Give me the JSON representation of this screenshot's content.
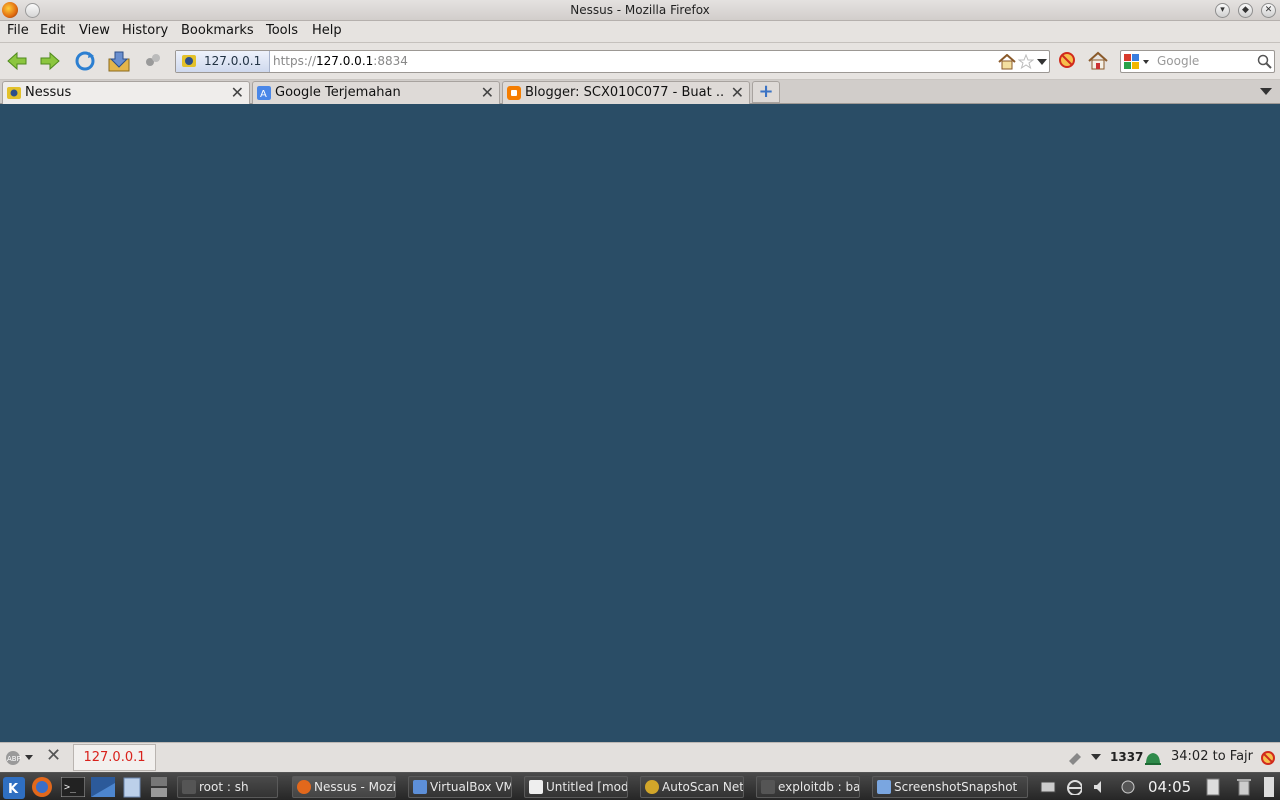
{
  "window": {
    "title": "Nessus - Mozilla Firefox"
  },
  "menubar": {
    "items": [
      "File",
      "Edit",
      "View",
      "History",
      "Bookmarks",
      "Tools",
      "Help"
    ]
  },
  "urlbar": {
    "identity": "127.0.0.1",
    "scheme": "https://",
    "host": "127.0.0.1",
    "port": ":8834"
  },
  "search": {
    "placeholder": "Google"
  },
  "tabs": [
    {
      "label": "Nessus",
      "active": true
    },
    {
      "label": "Google Terjemahan",
      "active": false
    },
    {
      "label": "Blogger: SCX010C077 - Buat ...",
      "active": false
    }
  ],
  "addonbar": {
    "host": "127.0.0.1",
    "count": "1337",
    "prayer": "34:02 to Fajr"
  },
  "taskbar": {
    "tasks": [
      {
        "label": "root : sh"
      },
      {
        "label": "Nessus - Mozi"
      },
      {
        "label": "VirtualBox VM"
      },
      {
        "label": "Untitled [mod"
      },
      {
        "label": "AutoScan Netv"
      },
      {
        "label": "exploitdb : bas"
      },
      {
        "label": "ScreenshotSnapshot"
      }
    ],
    "clock": "04:05"
  },
  "colors": {
    "content_bg": "#2a4d66",
    "status_host": "#d9221c"
  }
}
